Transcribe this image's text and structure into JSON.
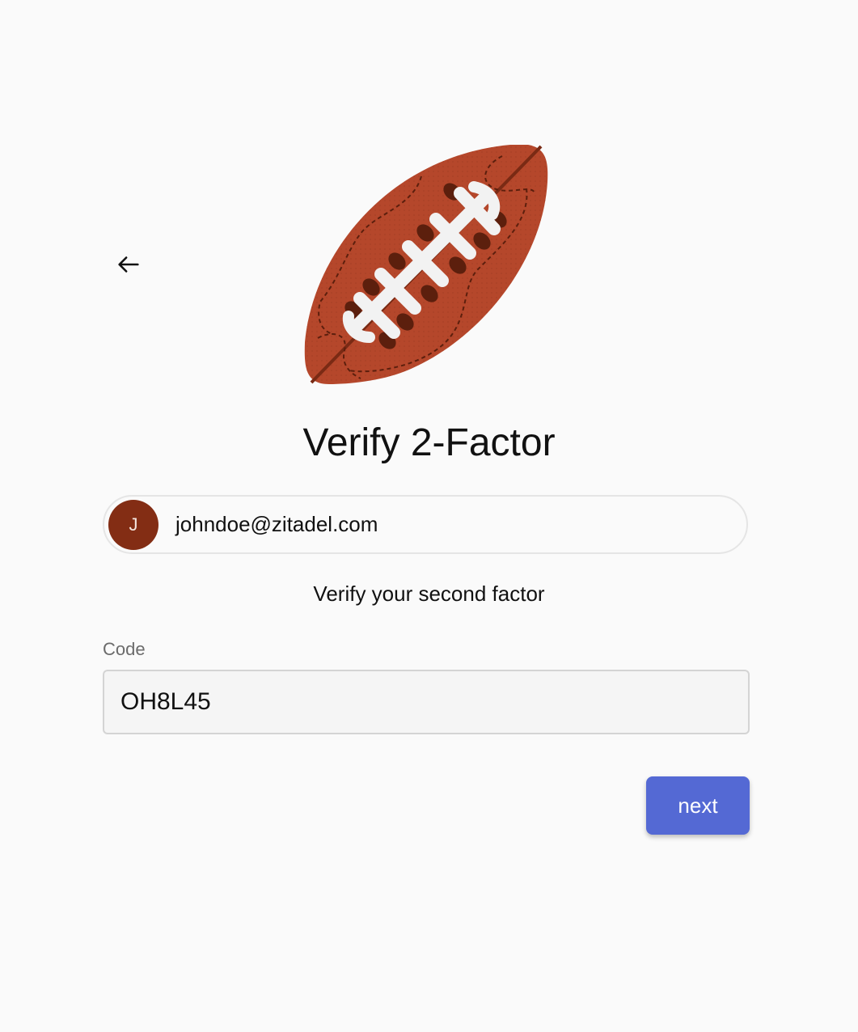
{
  "header": {
    "back_icon": "arrow-left-icon",
    "logo_icon": "american-football-icon"
  },
  "main": {
    "title": "Verify 2-Factor",
    "user": {
      "avatar_initial": "J",
      "email": "johndoe@zitadel.com"
    },
    "subtitle": "Verify your second factor",
    "code_field": {
      "label": "Code",
      "value": "OH8L45"
    },
    "next_label": "next"
  },
  "colors": {
    "background": "#fafafa",
    "accent": "#5469d4",
    "avatar": "#832d14",
    "football": "#b5472b"
  }
}
